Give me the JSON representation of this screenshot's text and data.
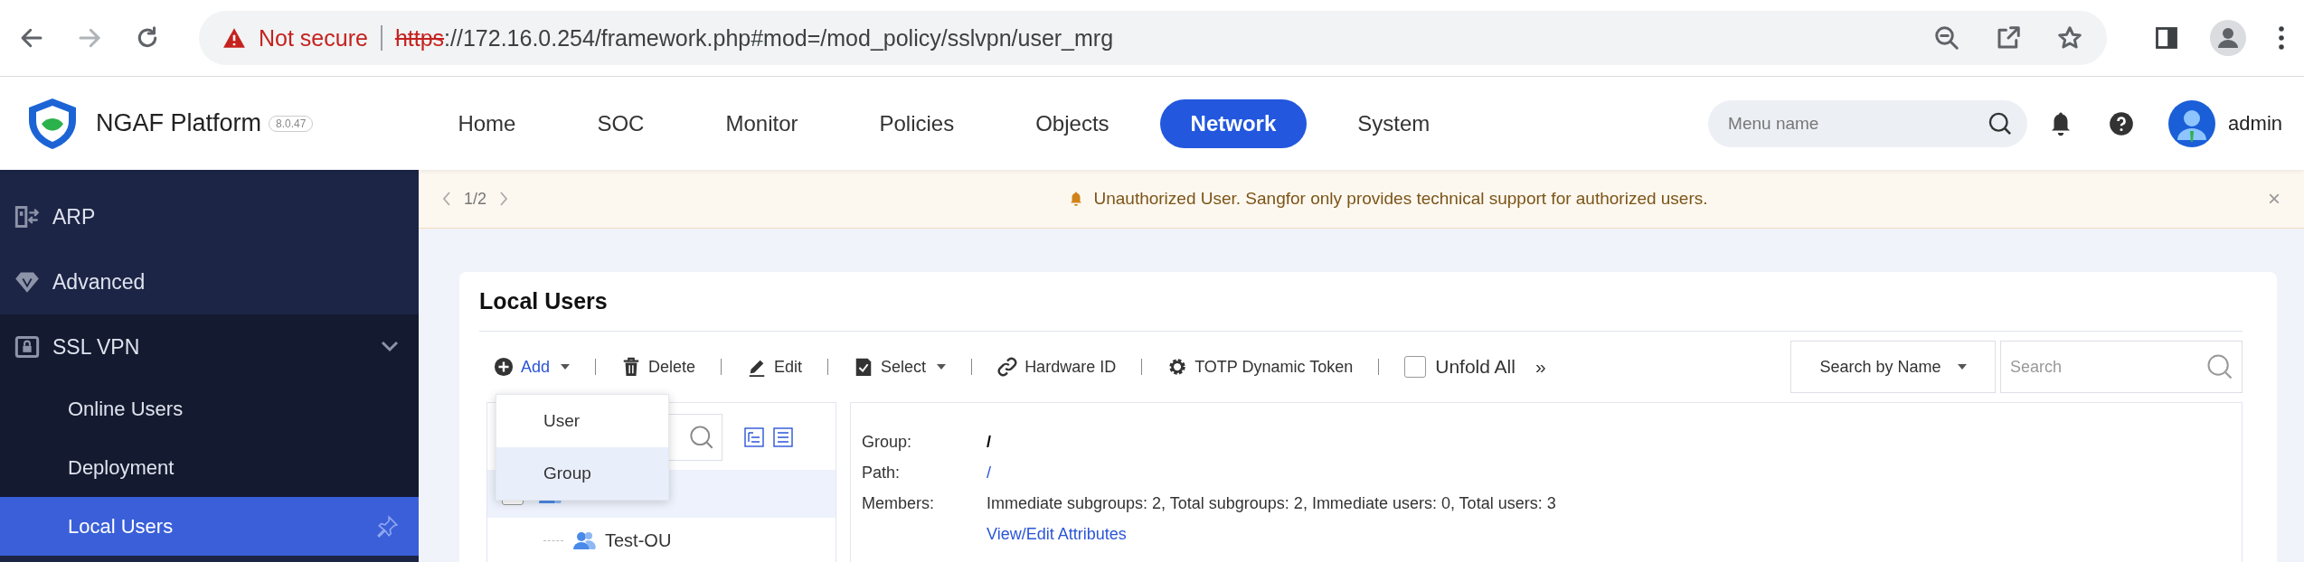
{
  "browser": {
    "security": "Not secure",
    "url_scheme": "https",
    "url_path": "://172.16.0.254/framework.php#mod=/mod_policy/sslvpn/user_mrg"
  },
  "header": {
    "product": "NGAF Platform",
    "version": "8.0.47",
    "nav": [
      {
        "label": "Home",
        "selected": false
      },
      {
        "label": "SOC",
        "selected": false
      },
      {
        "label": "Monitor",
        "selected": false
      },
      {
        "label": "Policies",
        "selected": false
      },
      {
        "label": "Objects",
        "selected": false
      },
      {
        "label": "Network",
        "selected": true
      },
      {
        "label": "System",
        "selected": false
      }
    ],
    "search": {
      "placeholder": "Menu name"
    },
    "user": "admin"
  },
  "sidebar": {
    "items": [
      {
        "label": "ARP",
        "selected": false
      },
      {
        "label": "Advanced",
        "selected": false
      },
      {
        "label": "SSL VPN",
        "selected": false,
        "expanded": true,
        "children": [
          {
            "label": "Online Users",
            "selected": false
          },
          {
            "label": "Deployment",
            "selected": false
          },
          {
            "label": "Local Users",
            "selected": true
          }
        ]
      }
    ]
  },
  "notice": {
    "pager": "1/2",
    "message": "Unauthorized User. Sangfor only provides technical support for authorized users.",
    "close": "×"
  },
  "card": {
    "title": "Local Users",
    "toolbar": [
      {
        "label": "Add",
        "has_menu": true,
        "open": true
      },
      {
        "label": "Delete",
        "has_menu": false,
        "open": false
      },
      {
        "label": "Edit",
        "has_menu": false,
        "open": false
      },
      {
        "label": "Select",
        "has_menu": true,
        "open": false
      },
      {
        "label": "Hardware ID",
        "has_menu": false,
        "open": false
      },
      {
        "label": "TOTP Dynamic Token",
        "has_menu": false,
        "open": false
      }
    ],
    "unfold_all": {
      "label": "Unfold All",
      "checked": false
    },
    "more": "»",
    "search_by": "Search by Name",
    "search": {
      "placeholder": "Search"
    },
    "add_menu": [
      {
        "label": "User",
        "selected": false
      },
      {
        "label": "Group",
        "selected": true
      }
    ],
    "tree": {
      "root": {
        "selected": true,
        "checked": false
      },
      "children": [
        {
          "label": "Test-OU"
        }
      ]
    },
    "details": [
      {
        "label": "Group:",
        "value": "/",
        "kind": "strong"
      },
      {
        "label": "Path:",
        "value": "/",
        "kind": "link"
      },
      {
        "label": "Members:",
        "value": "Immediate subgroups: 2, Total subgroups: 2, Immediate users: 0, Total users: 3",
        "kind": "plain"
      }
    ],
    "attributes_link": "View/Edit Attributes"
  }
}
